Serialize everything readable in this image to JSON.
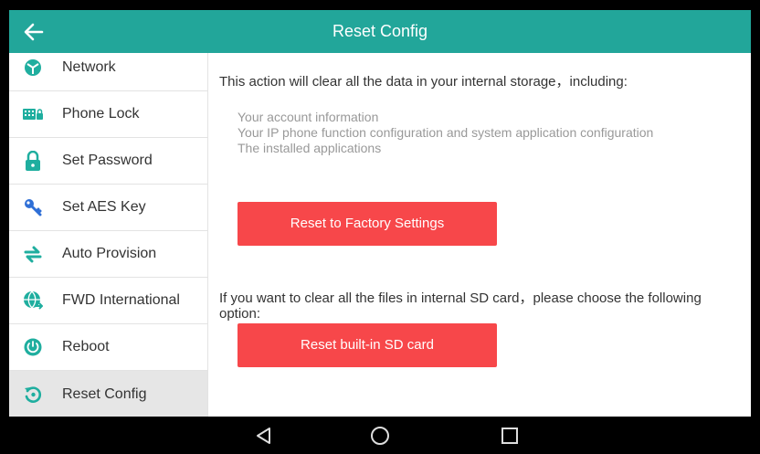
{
  "header": {
    "title": "Reset Config",
    "back_icon": "arrow-left-icon"
  },
  "sidebar": {
    "items": [
      {
        "label": "Network",
        "icon": "network-icon"
      },
      {
        "label": "Phone Lock",
        "icon": "keypad-lock-icon"
      },
      {
        "label": "Set Password",
        "icon": "padlock-icon"
      },
      {
        "label": "Set AES Key",
        "icon": "key-icon"
      },
      {
        "label": "Auto Provision",
        "icon": "sync-arrows-icon"
      },
      {
        "label": "FWD International",
        "icon": "globe-icon"
      },
      {
        "label": "Reboot",
        "icon": "reboot-icon"
      },
      {
        "label": "Reset Config",
        "icon": "reset-icon",
        "active": true
      }
    ]
  },
  "main": {
    "intro": "This action will clear all the data in your internal storage，including:",
    "list": [
      "Your account information",
      "Your IP phone function configuration and system application configuration",
      "The installed applications"
    ],
    "factory_button": "Reset to Factory Settings",
    "sd_text": "If you want to clear all the files in internal SD card，please choose the following option:",
    "sd_button": "Reset built-in SD card"
  },
  "navbar": {
    "back_icon": "triangle-back-icon",
    "home_icon": "circle-home-icon",
    "recents_icon": "square-recents-icon"
  },
  "colors": {
    "accent": "#22a69a",
    "button": "#f7474a",
    "icon": "#1fae9f",
    "key_icon": "#2f6fd6"
  }
}
